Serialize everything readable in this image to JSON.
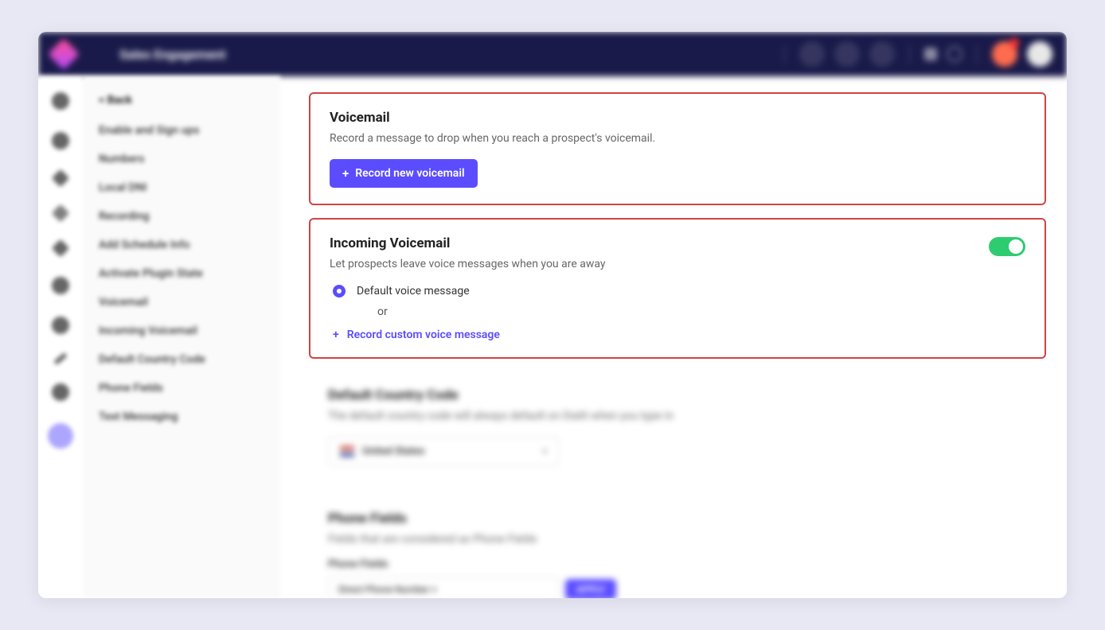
{
  "header": {
    "title": "Sales Engagement"
  },
  "sidebar": {
    "back": "< Back",
    "items": [
      "Enable and Sign ups",
      "Numbers",
      "Local DNI",
      "Recording",
      "Add Schedule Info",
      "Activate Plugin State",
      "Voicemail",
      "Incoming Voicemail",
      "Default Country Code",
      "Phone Fields",
      "Text Messaging"
    ]
  },
  "voicemail": {
    "title": "Voicemail",
    "desc": "Record a message to drop when you reach a prospect's voicemail.",
    "button": "Record new voicemail"
  },
  "incoming": {
    "title": "Incoming Voicemail",
    "desc": "Let prospects leave voice messages when you are away",
    "default_label": "Default voice message",
    "or": "or",
    "custom_link": "Record custom voice message",
    "toggle_on": true
  },
  "country": {
    "title": "Default Country Code",
    "desc": "The default country code will always default on Dialit when you type in",
    "selected": "United States"
  },
  "phone_fields": {
    "title": "Phone Fields",
    "desc": "Fields that are considered as Phone Fields",
    "label": "Phone Fields",
    "chip_value": "Direct Phone Number ×",
    "chip_btn": "APPLY"
  }
}
